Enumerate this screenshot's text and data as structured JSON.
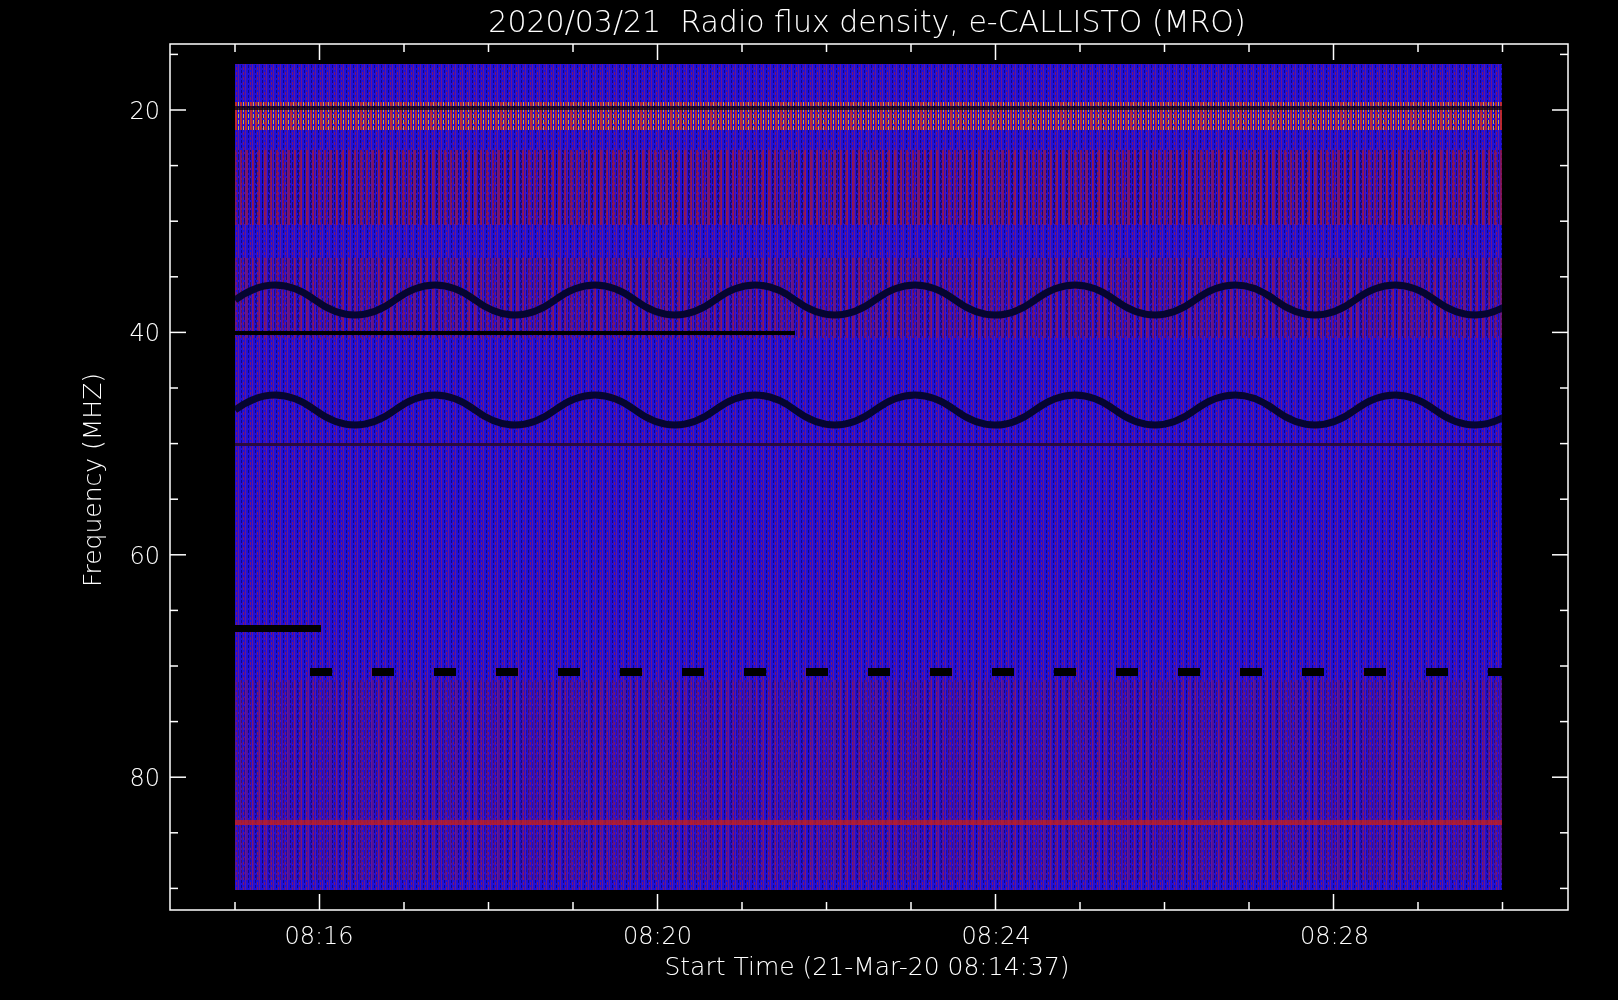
{
  "title": "2020/03/21  Radio flux density, e-CALLISTO (MRO)",
  "plot": {
    "kind": "spectrogram"
  },
  "y_axis": {
    "label": "Frequency (MHZ)",
    "ticks": [
      "20",
      "40",
      "60",
      "80"
    ]
  },
  "x_axis": {
    "label": "Start Time (21-Mar-20 08:14:37)",
    "ticks": [
      "08:16",
      "08:20",
      "08:24",
      "08:28"
    ]
  }
}
